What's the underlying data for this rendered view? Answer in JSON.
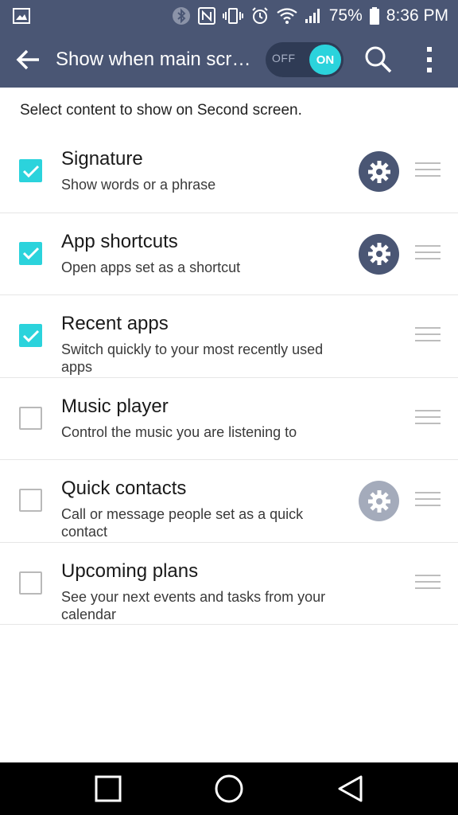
{
  "status_bar": {
    "battery_percent": "75%",
    "time": "8:36 PM",
    "icons": [
      "image-icon",
      "bluetooth-icon",
      "nfc-icon",
      "vibrate-icon",
      "alarm-icon",
      "wifi-icon",
      "signal-icon",
      "battery-icon"
    ]
  },
  "app_bar": {
    "title": "Show when main screen off",
    "toggle": {
      "off_label": "OFF",
      "on_label": "ON",
      "state": "on"
    }
  },
  "intro": "Select content to show on Second screen.",
  "items": [
    {
      "title": "Signature",
      "subtitle": "Show words or a phrase",
      "checked": true,
      "settings": "enabled"
    },
    {
      "title": "App shortcuts",
      "subtitle": "Open apps set as a shortcut",
      "checked": true,
      "settings": "enabled"
    },
    {
      "title": "Recent apps",
      "subtitle": "Switch quickly to your most recently used apps",
      "checked": true,
      "settings": "none"
    },
    {
      "title": "Music player",
      "subtitle": "Control the music you are listening to",
      "checked": false,
      "settings": "none"
    },
    {
      "title": "Quick contacts",
      "subtitle": "Call or message people set as a quick contact",
      "checked": false,
      "settings": "disabled"
    },
    {
      "title": "Upcoming plans",
      "subtitle": "See your next events and tasks from your calendar",
      "checked": false,
      "settings": "none"
    }
  ],
  "colors": {
    "header": "#4a5674",
    "accent": "#2bd3dc",
    "gear_disabled": "#a4abbb"
  }
}
